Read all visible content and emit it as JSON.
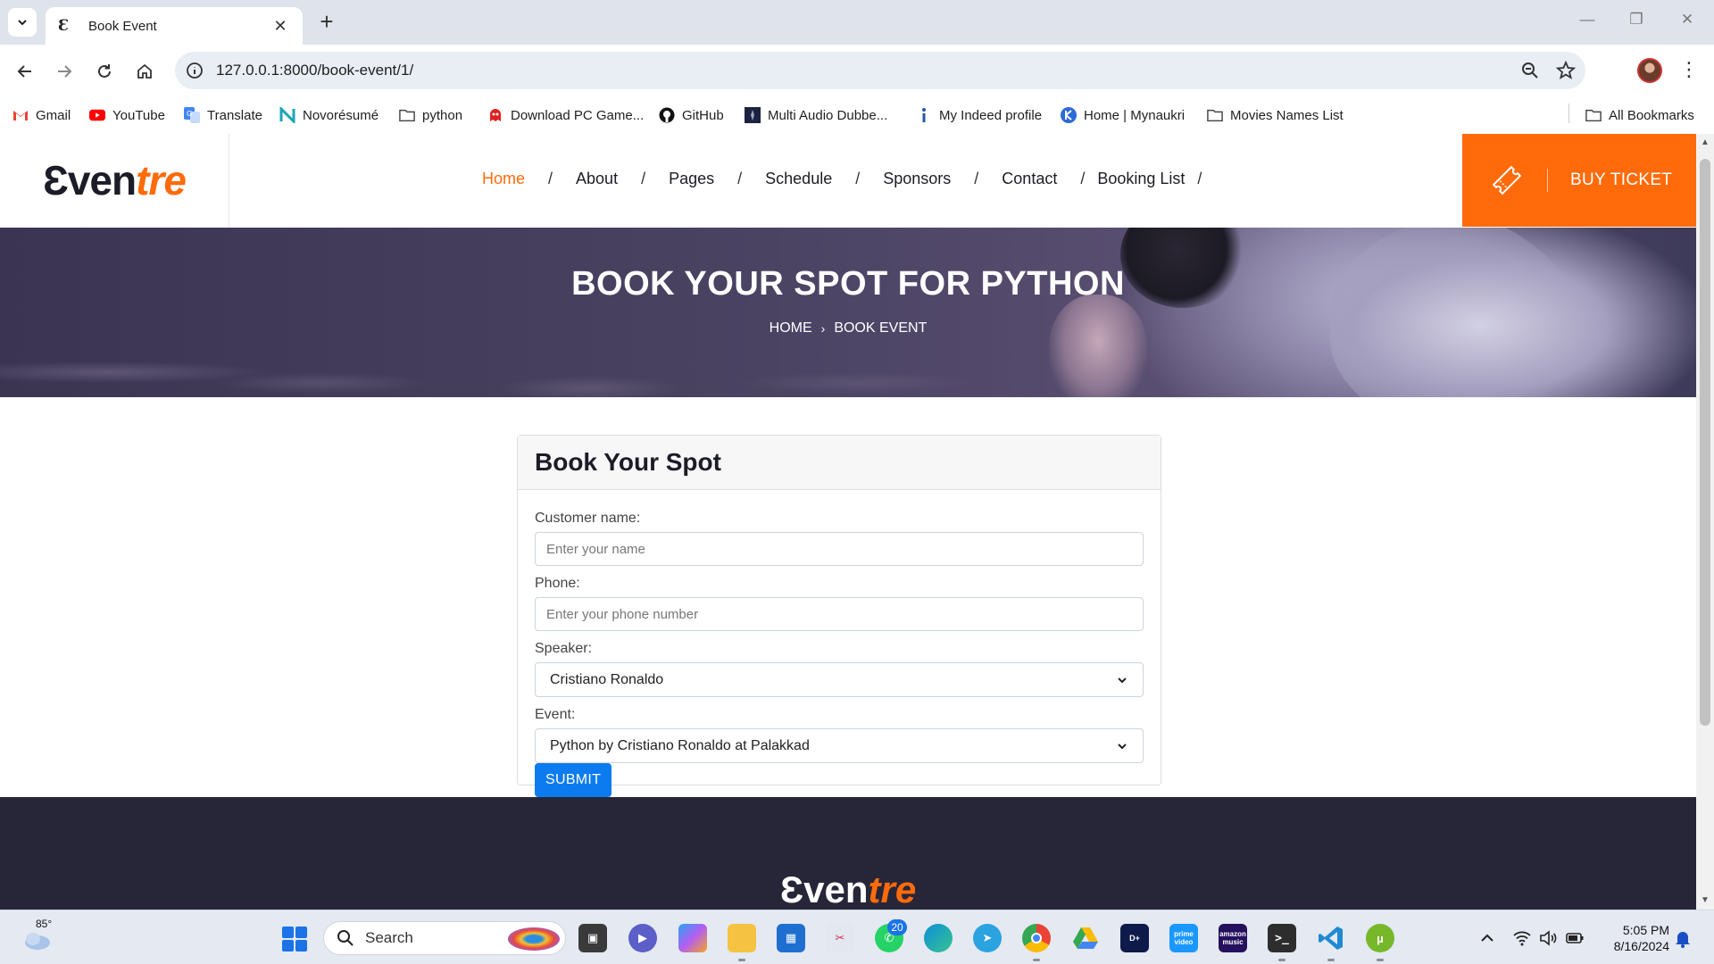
{
  "browser": {
    "tab_title": "Book Event",
    "tab_favicon": "Ɛ",
    "url": "127.0.0.1:8000/book-event/1/",
    "bookmarks": [
      {
        "label": "Gmail",
        "icon": "gmail-icon"
      },
      {
        "label": "YouTube",
        "icon": "youtube-icon"
      },
      {
        "label": "Translate",
        "icon": "translate-icon"
      },
      {
        "label": "Novorésumé",
        "icon": "novoresume-icon"
      },
      {
        "label": "python",
        "icon": "folder-icon"
      },
      {
        "label": "Download PC Game...",
        "icon": "game-icon"
      },
      {
        "label": "GitHub",
        "icon": "github-icon"
      },
      {
        "label": "Multi Audio Dubbe...",
        "icon": "dubbed-icon"
      },
      {
        "label": "My Indeed profile",
        "icon": "indeed-icon"
      },
      {
        "label": "Home | Mynaukri",
        "icon": "naukri-icon"
      },
      {
        "label": "Movies Names List",
        "icon": "folder-icon"
      }
    ],
    "all_bookmarks": "All Bookmarks"
  },
  "site": {
    "logo_dark": "Ɛven",
    "logo_orange": "tre",
    "nav": [
      {
        "label": "Home",
        "active": true
      },
      {
        "label": "About",
        "active": false
      },
      {
        "label": "Pages",
        "active": false
      },
      {
        "label": "Schedule",
        "active": false
      },
      {
        "label": "Sponsors",
        "active": false
      },
      {
        "label": "Contact",
        "active": false
      },
      {
        "label": "Booking List",
        "active": false
      }
    ],
    "nav_separator": "/",
    "buy_ticket": "BUY TICKET",
    "accent_color": "#ff6b0b"
  },
  "hero": {
    "title": "BOOK YOUR SPOT FOR PYTHON",
    "breadcrumb_home": "HOME",
    "breadcrumb_current": "BOOK EVENT"
  },
  "form": {
    "title": "Book Your Spot",
    "customer_label": "Customer name:",
    "customer_placeholder": "Enter your name",
    "phone_label": "Phone:",
    "phone_placeholder": "Enter your phone number",
    "speaker_label": "Speaker:",
    "speaker_value": "Cristiano Ronaldo",
    "event_label": "Event:",
    "event_value": "Python by Cristiano Ronaldo at Palakkad",
    "submit_label": "SUBMIT",
    "submit_color": "#0d7bf0"
  },
  "footer": {
    "logo_light": "Ɛven",
    "logo_orange": "tre"
  },
  "taskbar": {
    "weather_temp": "85°",
    "search_label": "Search",
    "whatsapp_badge": "20",
    "apps": [
      "file-manager-icon",
      "meet-icon",
      "copilot-icon",
      "file-explorer-icon",
      "store-icon",
      "snipping-tool-icon",
      "whatsapp-icon",
      "edge-icon",
      "telegram-icon",
      "chrome-icon",
      "drive-icon",
      "disney-plus-icon",
      "prime-video-icon",
      "amazon-music-icon",
      "terminal-icon",
      "vscode-icon",
      "utorrent-icon"
    ],
    "prime_label": "prime video",
    "amazon_music_label": "amazon music",
    "time": "5:05 PM",
    "date": "8/16/2024"
  }
}
